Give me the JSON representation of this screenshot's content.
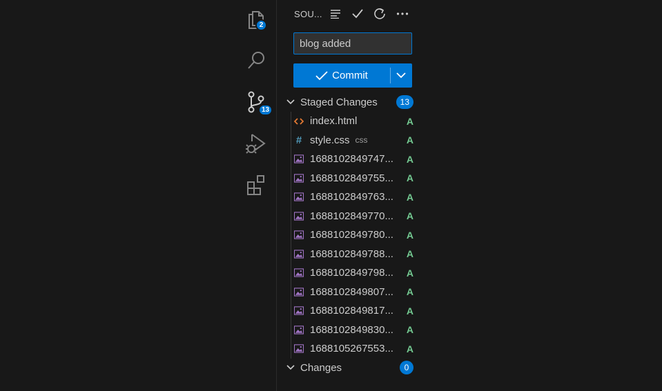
{
  "activity_bar": {
    "explorer_badge": "2",
    "scm_badge": "13"
  },
  "scm": {
    "title": "SOU...",
    "message_value": "blog added",
    "commit_label": "Commit"
  },
  "staged": {
    "label": "Staged Changes",
    "count": "13",
    "files": [
      {
        "name": "index.html",
        "desc": "",
        "status": "A",
        "icon": "html-file-icon"
      },
      {
        "name": "style.css",
        "desc": "css",
        "status": "A",
        "icon": "css-file-icon"
      },
      {
        "name": "1688102849747...",
        "desc": "",
        "status": "A",
        "icon": "image-file-icon"
      },
      {
        "name": "1688102849755...",
        "desc": "",
        "status": "A",
        "icon": "image-file-icon"
      },
      {
        "name": "1688102849763...",
        "desc": "",
        "status": "A",
        "icon": "image-file-icon"
      },
      {
        "name": "1688102849770...",
        "desc": "",
        "status": "A",
        "icon": "image-file-icon"
      },
      {
        "name": "1688102849780...",
        "desc": "",
        "status": "A",
        "icon": "image-file-icon"
      },
      {
        "name": "1688102849788...",
        "desc": "",
        "status": "A",
        "icon": "image-file-icon"
      },
      {
        "name": "1688102849798...",
        "desc": "",
        "status": "A",
        "icon": "image-file-icon"
      },
      {
        "name": "1688102849807...",
        "desc": "",
        "status": "A",
        "icon": "image-file-icon"
      },
      {
        "name": "1688102849817...",
        "desc": "",
        "status": "A",
        "icon": "image-file-icon"
      },
      {
        "name": "1688102849830...",
        "desc": "",
        "status": "A",
        "icon": "image-file-icon"
      },
      {
        "name": "1688105267553...",
        "desc": "",
        "status": "A",
        "icon": "image-file-icon"
      }
    ]
  },
  "changes": {
    "label": "Changes",
    "count": "0"
  },
  "colors": {
    "accent": "#0078d4",
    "added": "#73c991",
    "background": "#181818"
  }
}
